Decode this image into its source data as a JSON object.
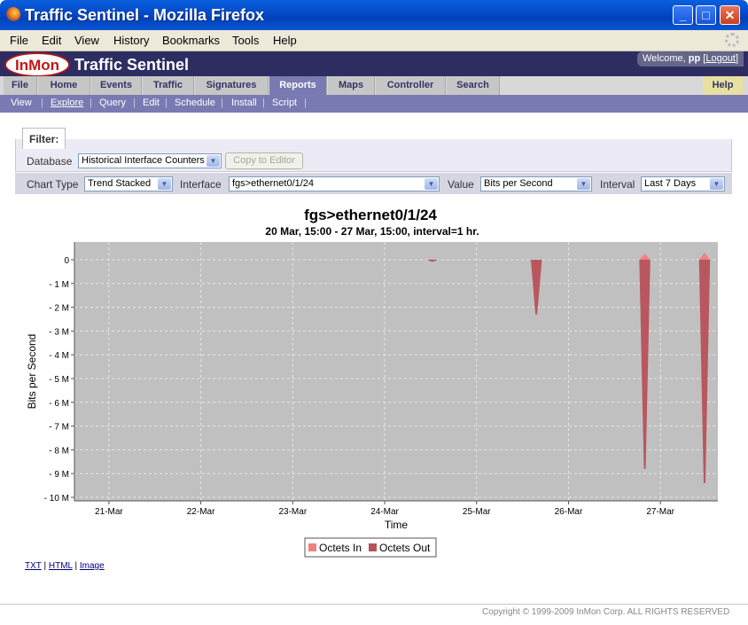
{
  "window": {
    "title": "Traffic Sentinel - Mozilla Firefox",
    "buttons": {
      "minimize": "_",
      "maximize": "□",
      "close": "✕"
    }
  },
  "menubar": [
    "File",
    "Edit",
    "View",
    "History",
    "Bookmarks",
    "Tools",
    "Help"
  ],
  "app": {
    "logo_text": "InMon",
    "title": "Traffic Sentinel",
    "welcome_prefix": "Welcome,",
    "user": "pp",
    "logout": "Logout"
  },
  "nav": {
    "tabs": [
      "File",
      "Home",
      "Events",
      "Traffic",
      "Signatures",
      "Reports",
      "Maps",
      "Controller",
      "Search"
    ],
    "active": "Reports",
    "help": "Help"
  },
  "subnav": [
    "View",
    "Explore",
    "Query",
    "Edit",
    "Schedule",
    "Install",
    "Script"
  ],
  "filter": {
    "legend": "Filter:",
    "database_label": "Database",
    "database_value": "Historical Interface Counters",
    "copy_button": "Copy to Editor"
  },
  "controls": {
    "chart_type_label": "Chart Type",
    "chart_type_value": "Trend Stacked",
    "interface_label": "Interface",
    "interface_value": "fgs>ethernet0/1/24",
    "value_label": "Value",
    "value_value": "Bits per Second",
    "interval_label": "Interval",
    "interval_value": "Last 7 Days"
  },
  "chart_data": {
    "type": "area",
    "title": "fgs>ethernet0/1/24",
    "subtitle": "20 Mar, 15:00 -  27 Mar, 15:00, interval=1 hr.",
    "xlabel": "Time",
    "ylabel": "Bits per Second",
    "x_ticks": [
      "21-Mar",
      "22-Mar",
      "23-Mar",
      "24-Mar",
      "25-Mar",
      "26-Mar",
      "27-Mar"
    ],
    "y_ticks": [
      "0",
      "- 1 M",
      "- 2 M",
      "- 3 M",
      "- 4 M",
      "- 5 M",
      "- 6 M",
      "- 7 M",
      "- 8 M",
      "- 9 M",
      "- 10 M"
    ],
    "ylim": [
      -10000000,
      0
    ],
    "xlim_days": [
      20.625,
      27.625
    ],
    "grid": true,
    "series": [
      {
        "name": "Octets In",
        "color": "#f08080",
        "spikes": [
          {
            "day": 24.52,
            "value": 20000
          },
          {
            "day": 26.83,
            "value": 250000
          },
          {
            "day": 27.48,
            "value": 300000
          }
        ]
      },
      {
        "name": "Octets Out",
        "color": "#b85058",
        "spikes": [
          {
            "day": 24.52,
            "value": -80000
          },
          {
            "day": 25.65,
            "value": -2300000
          },
          {
            "day": 26.83,
            "value": -8800000
          },
          {
            "day": 27.48,
            "value": -9400000
          }
        ]
      }
    ]
  },
  "export_links": [
    "TXT",
    "HTML",
    "Image"
  ],
  "footer": "Copyright © 1999-2009 InMon Corp. ALL RIGHTS RESERVED"
}
